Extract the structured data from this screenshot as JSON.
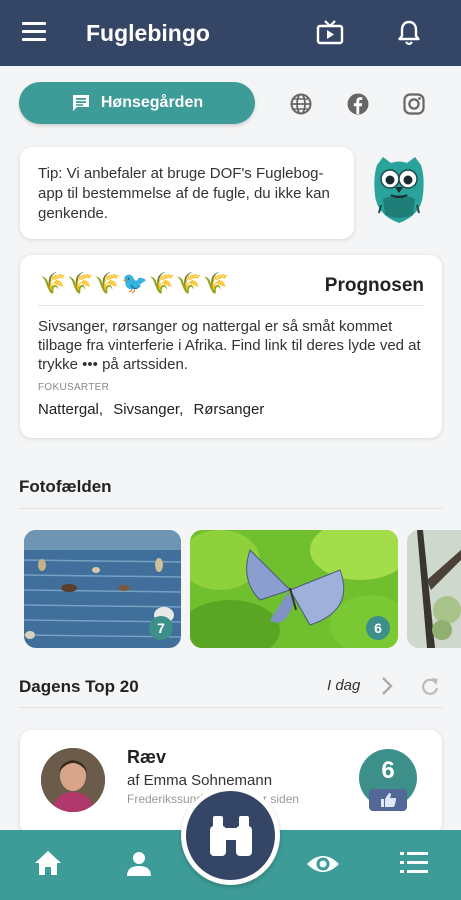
{
  "app": {
    "title": "Fuglebingo"
  },
  "header": {
    "menu_icon": "hamburger-menu-icon",
    "tv_icon": "tv-icon",
    "bell_icon": "bell-icon"
  },
  "location_button": {
    "label": "Hønsegården",
    "icon": "chat-message-icon"
  },
  "social": [
    "globe-icon",
    "facebook-icon",
    "instagram-icon"
  ],
  "tip": {
    "text": "Tip: Vi anbefaler at bruge DOF's Fuglebog-app til bestemmelse af de fugle, du ikke kan genkende."
  },
  "prognosis": {
    "title": "Prognosen",
    "birds": "🌾🌾🌾🐦🌾🌾🌾",
    "text": "Sivsanger, rørsanger og nattergal er så småt kommet tilbage fra vinterferie i Afrika. Find link til deres lyde ved at trykke ••• på artssiden.",
    "focus_label": "FOKUSARTER",
    "focus_species": [
      "Nattergal,",
      "Sivsanger,",
      "Rørsanger"
    ]
  },
  "photo_trap": {
    "title": "Fotofælden",
    "photos": [
      {
        "badge": "7",
        "icon": "water-birds-photo"
      },
      {
        "badge": "6",
        "icon": "butterfly-photo"
      },
      {
        "badge": "",
        "icon": "tree-photo"
      }
    ]
  },
  "top20": {
    "title": "Dagens Top 20",
    "filter": "I dag",
    "entry": {
      "bird": "Ræv",
      "byline": "af Emma Sohnemann",
      "location": "Frederikssund · 2 minutter siden",
      "score": "6"
    }
  },
  "nav": {
    "items": [
      "home-icon",
      "person-icon",
      "binoculars-icon",
      "eye-icon",
      "list-icon"
    ]
  },
  "colors": {
    "header": "#354565",
    "accent": "#3d9c97",
    "badge": "#3d8f8a"
  }
}
